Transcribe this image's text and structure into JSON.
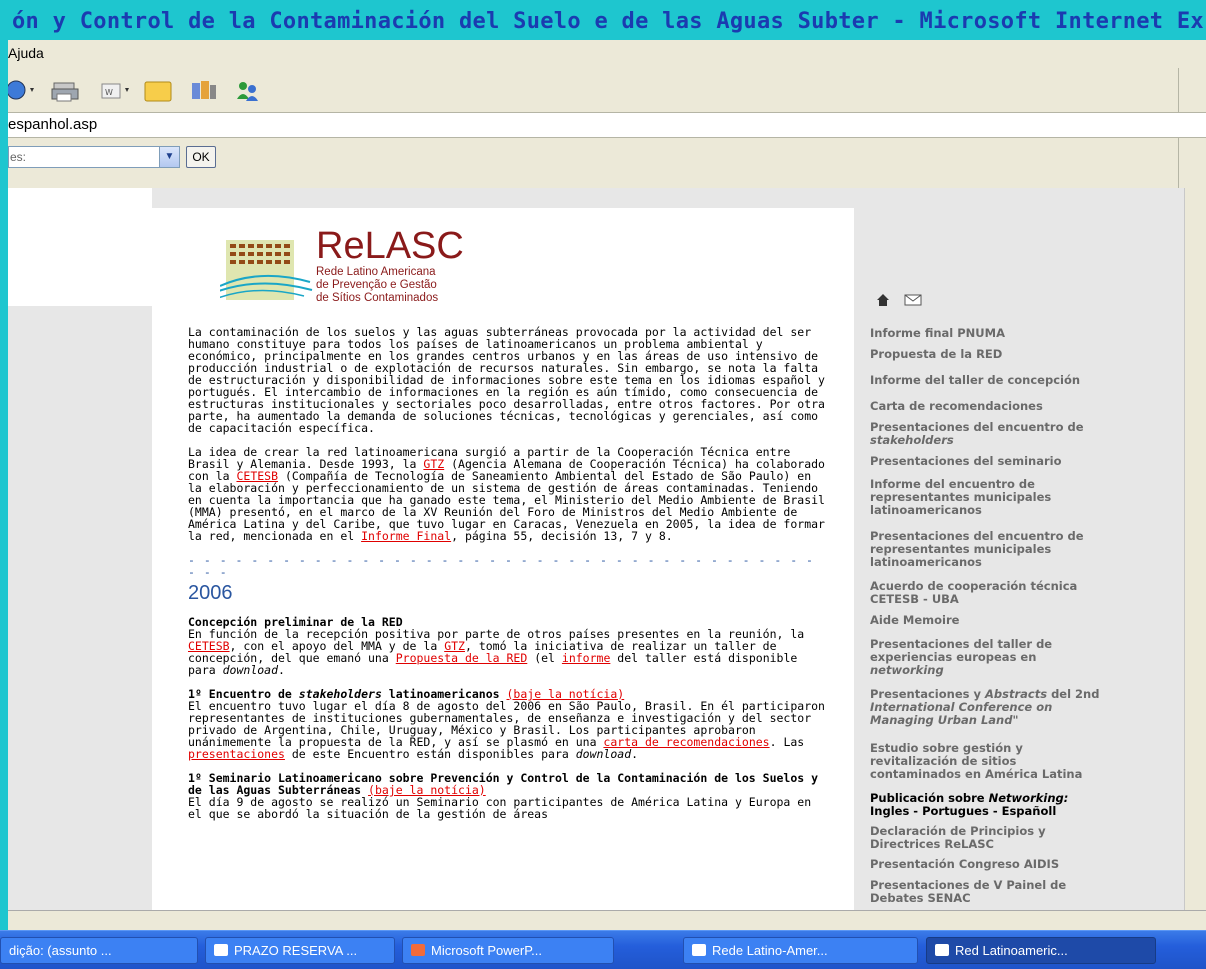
{
  "window": {
    "title": "ón y Control de la Contaminación del Suelo e de las Aguas Subter - Microsoft Internet Ex"
  },
  "menubar": {
    "items": [
      "Ajuda"
    ]
  },
  "address": {
    "value": "espanhol.asp"
  },
  "links": {
    "combo_value": "es:",
    "ok_label": "OK"
  },
  "logo": {
    "name": "ReLASC",
    "subtitle_lines": [
      "Rede Latino Americana",
      "de Prevenção e Gestão",
      "de Sítios Contaminados"
    ]
  },
  "main": {
    "p1": "La contaminación de los suelos y las aguas subterráneas provocada por la actividad del ser humano constituye para todos los países de latinoamericanos un problema ambiental y económico, principalmente en los grandes centros urbanos y en las áreas de uso intensivo de producción industrial o de explotación de recursos naturales. Sin embargo, se nota la falta de estructuración y disponibilidad de informaciones sobre este tema en los idiomas español y portugués. El intercambio de informaciones en la región es aún tímido, como consecuencia de estructuras institucionales y sectoriales poco desarrolladas, entre otros factores. Por otra parte, ha aumentado la demanda de soluciones técnicas, tecnológicas y gerenciales, así como de capacitación específica.",
    "p2_a": "La idea de crear la red latinoamericana surgió a partir de la Cooperación Técnica entre Brasil y Alemania. Desde 1993, la ",
    "p2_link_gtz": "GTZ",
    "p2_b": " (Agencia Alemana de Cooperación Técnica) ha colaborado con la ",
    "p2_link_cetesb": "CETESB",
    "p2_c": " (Compañía de Tecnología de Saneamiento Ambiental del Estado de São Paulo) en la elaboración y perfeccionamiento de un sistema de gestión de áreas contaminadas. Teniendo en cuenta la importancia que ha ganado este tema, el Ministerio del Medio Ambiente de Brasil (MMA) presentó, en el marco de la XV Reunión del Foro de Ministros del Medio Ambiente de América Latina y del Caribe, que tuvo lugar en Caracas, Venezuela en 2005, la idea de formar la red, mencionada en el ",
    "p2_link_informe": "Informe Final",
    "p2_d": ", página 55, decisión 13, 7 y 8.",
    "divider": "- - - - - - - - - - - - - - - - - - - - - - - - - - - - - - - - - - - - - - - - - - -",
    "year": "2006",
    "s1_title": "Concepción preliminar de la RED",
    "s1_a": "En función de la recepción positiva por parte de otros países presentes en la reunión, la ",
    "s1_link_cetesb": "CETESB",
    "s1_b": ", con el apoyo del MMA y de la ",
    "s1_link_gtz": "GTZ",
    "s1_c": ", tomó la iniciativa de realizar un taller de concepción, del que emanó una ",
    "s1_link_propuesta": "Propuesta de la RED",
    "s1_d": " (el ",
    "s1_link_informe": "informe",
    "s1_e": " del taller está disponible para ",
    "s1_download": "download",
    "s1_f": ".",
    "s2_title_a": "1º Encuentro de ",
    "s2_title_i": "stakeholders",
    "s2_title_b": " latinoamericanos ",
    "s2_link_baje": "(baje la notícia)",
    "s2_a": "El encuentro tuvo lugar el día 8 de agosto del 2006 en São Paulo, Brasil. En él participaron representantes de instituciones gubernamentales, de enseñanza e investigación y del sector privado de Argentina, Chile, Uruguay, México y Brasil. Los participantes aprobaron unánimemente la propuesta de la RED, y así se plasmó en una ",
    "s2_link_carta": "carta de recomendaciones",
    "s2_b": ". Las ",
    "s2_link_pres": "presentaciones",
    "s2_c": " de este Encuentro están disponibles para ",
    "s2_download": "download",
    "s2_d": ".",
    "s3_title": "1º Seminario Latinoamericano sobre Prevención y Control de la Contaminación de los Suelos y de las Aguas Subterráneas ",
    "s3_link_baje": "(baje la notícia)",
    "s3_a": "El día 9 de agosto se realizó un Seminario con participantes de América Latina y Europa en el que se abordó la situación de la gestión de áreas"
  },
  "sidebar": {
    "items": [
      "Informe final PNUMA",
      "Propuesta de la RED",
      "Informe del taller de concepción",
      "Carta de recomendaciones",
      "Presentaciones del encuentro de",
      "stakeholders",
      "Presentaciones del seminario",
      "Informe del encuentro de",
      "representantes municipales",
      "latinoamericanos",
      "Presentaciones del encuentro de",
      "representantes municipales",
      "latinoamericanos",
      "Acuerdo de cooperación técnica",
      "CETESB - UBA",
      "Aide Memoire",
      "Presentaciones del taller de",
      "experiencias europeas en",
      "networking",
      "Presentaciones y ",
      "Abstracts",
      " del 2nd",
      "International Conference on",
      "Managing Urban Land\"",
      "Estudio sobre gestión y",
      "revitalización de sitios",
      "contaminados en América Latina",
      "Publicación sobre ",
      "Networking:",
      "Ingles - Portugues - Españoll",
      "Declaración de Principios y",
      "Directrices ReLASC",
      "Presentación Congreso AIDIS",
      "Presentaciones de V Painel de",
      "Debates SENAC"
    ]
  },
  "taskbar": {
    "tasks": [
      "dição: (assunto ...",
      "PRAZO RESERVA ...",
      "Microsoft PowerP...",
      "Rede Latino-Amer...",
      "Red Latinoameric..."
    ]
  },
  "colors": {
    "link": "#e00000",
    "year": "#2a56a0",
    "taskbar": "#245edb",
    "outer_bg": "#1ec6cf"
  }
}
